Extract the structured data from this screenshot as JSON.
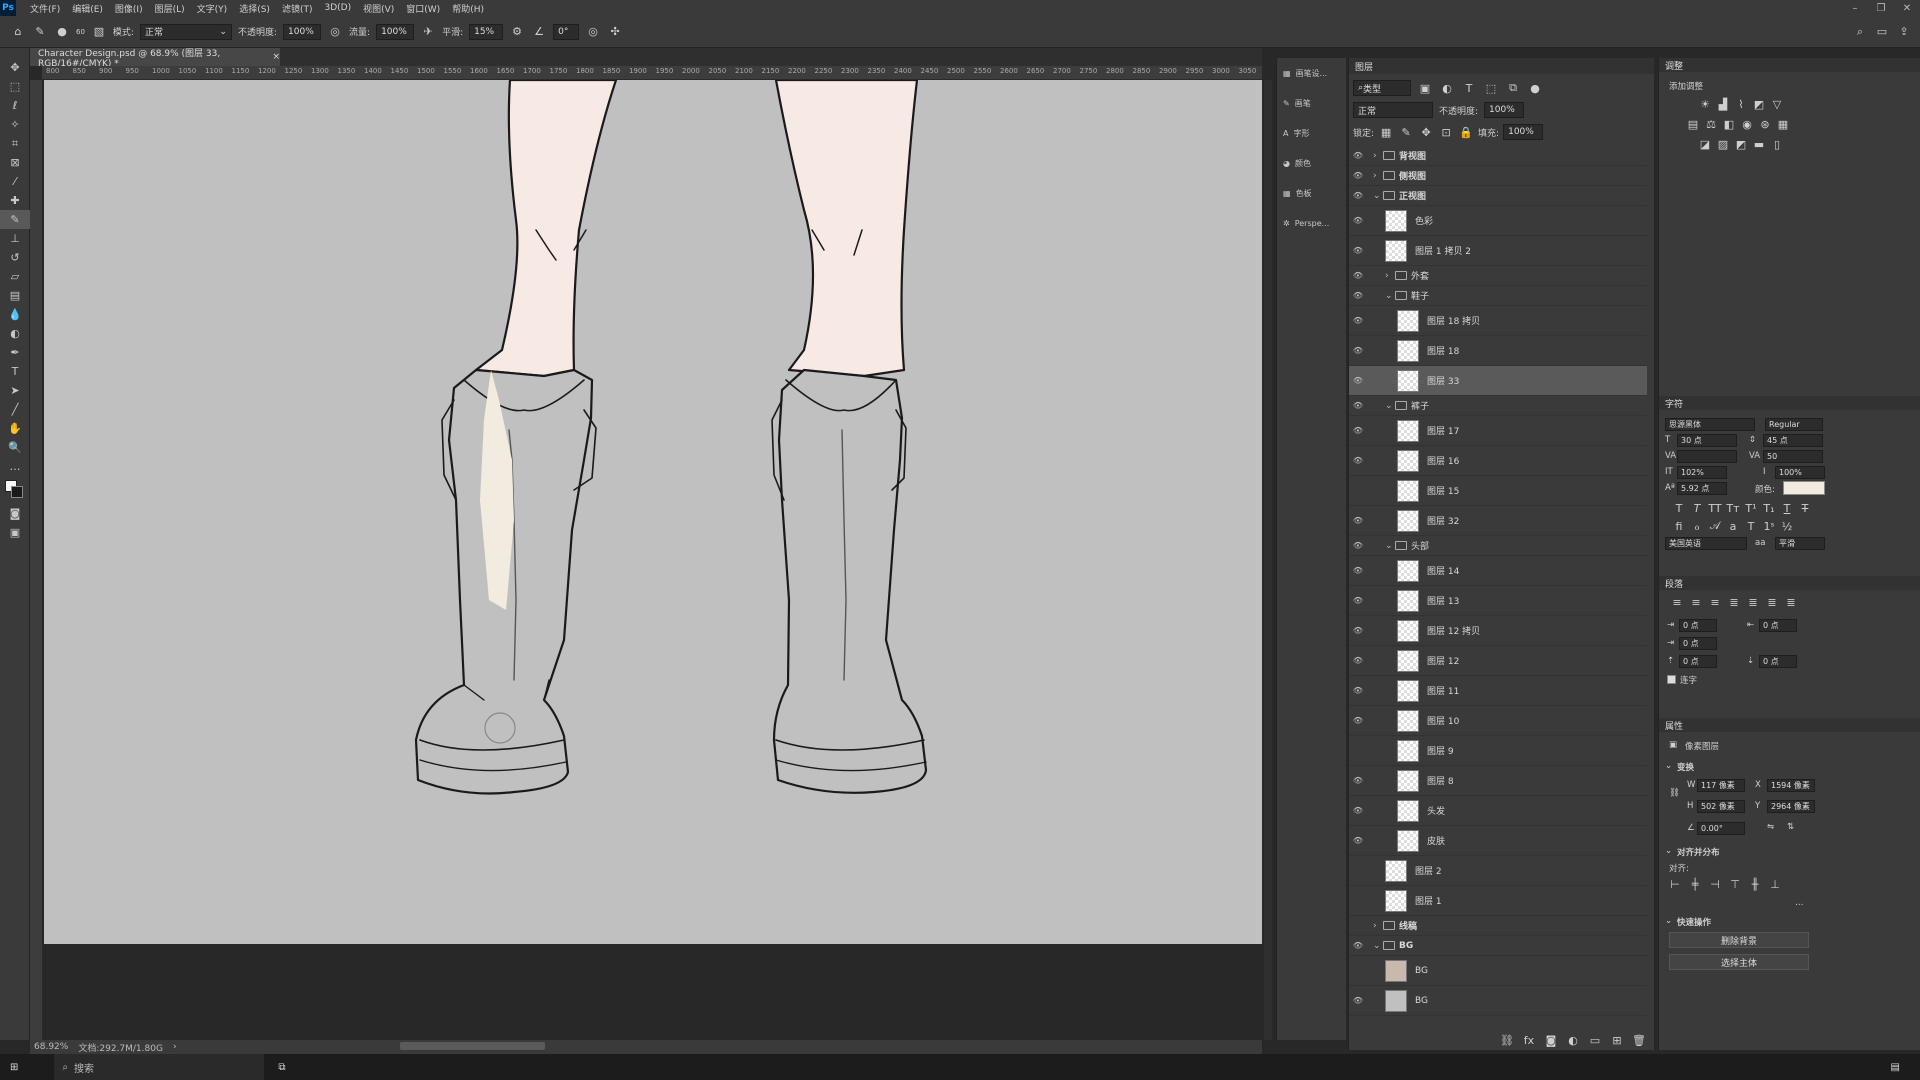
{
  "menubar": {
    "app_icon": "Ps",
    "items": [
      "文件(F)",
      "编辑(E)",
      "图像(I)",
      "图层(L)",
      "文字(Y)",
      "选择(S)",
      "滤镜(T)",
      "3D(D)",
      "视图(V)",
      "窗口(W)",
      "帮助(H)"
    ]
  },
  "options": {
    "mode_label": "模式:",
    "mode_value": "正常",
    "opacity_label": "不透明度:",
    "opacity_value": "100%",
    "flow_label": "流量:",
    "flow_value": "100%",
    "smooth_label": "平滑:",
    "smooth_value": "15%",
    "angle_value": "0°",
    "brush_size": "60"
  },
  "document": {
    "tab_title": "Character Design.psd @ 68.9% (图层 33, RGB/16#/CMYK) *",
    "zoom": "68.92%",
    "doc_info": "文档:292.7M/1.80G"
  },
  "ruler": [
    "800",
    "850",
    "900",
    "950",
    "1000",
    "1050",
    "1100",
    "1150",
    "1200",
    "1250",
    "1300",
    "1350",
    "1400",
    "1450",
    "1500",
    "1550",
    "1600",
    "1650",
    "1700",
    "1750",
    "1800",
    "1850",
    "1900",
    "1950",
    "2000",
    "2050",
    "2100",
    "2150",
    "2200",
    "2250",
    "2300",
    "2350",
    "2400",
    "2450",
    "2500",
    "2550",
    "2600",
    "2650",
    "2700",
    "2750",
    "2800",
    "2850",
    "2900",
    "2950",
    "3000",
    "3050"
  ],
  "minipanel": [
    {
      "icon": "brush-settings-icon",
      "label": "画笔设..."
    },
    {
      "icon": "brush-icon",
      "label": "画笔"
    },
    {
      "icon": "character-icon",
      "label": "字形"
    },
    {
      "icon": "color-icon",
      "label": "颜色"
    },
    {
      "icon": "swatches-icon",
      "label": "色板"
    },
    {
      "icon": "perspective-icon",
      "label": "Perspe..."
    }
  ],
  "layers_panel": {
    "tab": "图层",
    "filter_label": "类型",
    "blend_mode": "正常",
    "opacity_label": "不透明度:",
    "opacity_value": "100%",
    "lock_label": "锁定:",
    "fill_label": "填充:",
    "fill_value": "100%",
    "rows": [
      {
        "name": "背视图",
        "kind": "group",
        "indent": 0,
        "visible": true
      },
      {
        "name": "侧视图",
        "kind": "group",
        "indent": 0,
        "visible": true
      },
      {
        "name": "正视图",
        "kind": "group-open",
        "indent": 0,
        "visible": true
      },
      {
        "name": "色彩",
        "kind": "layer",
        "indent": 1,
        "visible": true
      },
      {
        "name": "图层 1 拷贝 2",
        "kind": "layer",
        "indent": 1,
        "visible": true
      },
      {
        "name": "外套",
        "kind": "group",
        "indent": 1,
        "visible": true
      },
      {
        "name": "鞋子",
        "kind": "group-open",
        "indent": 1,
        "visible": true
      },
      {
        "name": "图层 18 拷贝",
        "kind": "layer",
        "indent": 2,
        "visible": true
      },
      {
        "name": "图层 18",
        "kind": "layer",
        "indent": 2,
        "visible": true
      },
      {
        "name": "图层 33",
        "kind": "layer",
        "indent": 2,
        "visible": true,
        "selected": true
      },
      {
        "name": "裤子",
        "kind": "group-open",
        "indent": 1,
        "visible": true
      },
      {
        "name": "图层 17",
        "kind": "layer",
        "indent": 2,
        "visible": true
      },
      {
        "name": "图层 16",
        "kind": "layer",
        "indent": 2,
        "visible": true
      },
      {
        "name": "图层 15",
        "kind": "layer",
        "indent": 2,
        "visible": false
      },
      {
        "name": "图层 32",
        "kind": "layer",
        "indent": 2,
        "visible": true
      },
      {
        "name": "头部",
        "kind": "group-open",
        "indent": 1,
        "visible": true
      },
      {
        "name": "图层 14",
        "kind": "layer",
        "indent": 2,
        "visible": true
      },
      {
        "name": "图层 13",
        "kind": "layer",
        "indent": 2,
        "visible": true
      },
      {
        "name": "图层 12 拷贝",
        "kind": "layer",
        "indent": 2,
        "visible": true
      },
      {
        "name": "图层 12",
        "kind": "layer",
        "indent": 2,
        "visible": true
      },
      {
        "name": "图层 11",
        "kind": "layer",
        "indent": 2,
        "visible": true
      },
      {
        "name": "图层 10",
        "kind": "layer",
        "indent": 2,
        "visible": true
      },
      {
        "name": "图层 9",
        "kind": "layer",
        "indent": 2,
        "visible": false
      },
      {
        "name": "图层 8",
        "kind": "layer",
        "indent": 2,
        "visible": true
      },
      {
        "name": "头发",
        "kind": "layer",
        "indent": 2,
        "visible": true
      },
      {
        "name": "皮肤",
        "kind": "layer",
        "indent": 2,
        "visible": true
      },
      {
        "name": "图层 2",
        "kind": "layer",
        "indent": 1,
        "visible": false
      },
      {
        "name": "图层 1",
        "kind": "layer",
        "indent": 1,
        "visible": false
      },
      {
        "name": "线稿",
        "kind": "group",
        "indent": 0,
        "visible": false
      },
      {
        "name": "BG",
        "kind": "group-open",
        "indent": 0,
        "visible": true
      },
      {
        "name": "BG",
        "kind": "layer-tan",
        "indent": 1,
        "visible": false
      },
      {
        "name": "BG",
        "kind": "layer-grey",
        "indent": 1,
        "visible": true
      }
    ]
  },
  "adjustments": {
    "tab": "调整",
    "add_label": "添加调整"
  },
  "character": {
    "tab": "字符",
    "font_family": "思源黑体",
    "font_style": "Regular",
    "font_size": "30 点",
    "leading": "45 点",
    "tracking": "50",
    "vscale": "102%",
    "hscale": "100%",
    "baseline": "5.92 点",
    "color_label": "颜色:",
    "language": "美国英语",
    "aa": "平滑"
  },
  "paragraph": {
    "tab": "段落",
    "indent_left": "0 点",
    "indent_right": "0 点",
    "indent_first": "0 点",
    "space_before": "0 点",
    "space_after": "0 点",
    "hyphenate": "连字"
  },
  "properties": {
    "tab": "属性",
    "type": "像素图层",
    "transform_label": "变换",
    "w_label": "W",
    "w": "117 像素",
    "x_label": "X",
    "x": "1594 像素",
    "h_label": "H",
    "h": "502 像素",
    "y_label": "Y",
    "y": "2964 像素",
    "angle": "0.00°",
    "align_label": "对齐并分布",
    "align_sub": "对齐:",
    "quick_label": "快速操作",
    "btn_remove_bg": "删除背景",
    "btn_select_subject": "选择主体"
  },
  "taskbar": {
    "search_placeholder": "搜索"
  },
  "colors": {
    "canvas_bg": "#c0c0c0",
    "skin": "#f7e9e4",
    "line": "#1a1a1a",
    "accent_highlight": "#f2ece0"
  }
}
